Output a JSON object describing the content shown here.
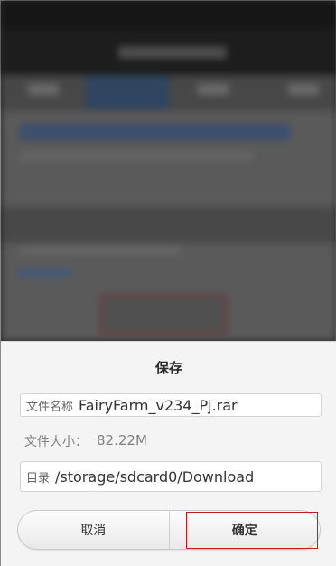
{
  "dialog": {
    "title": "保存",
    "filename_label": "文件名称",
    "filename_value": "FairyFarm_v234_Pj.rar",
    "size_label": "文件大小：",
    "size_value": "82.22M",
    "directory_label": "目录",
    "directory_value": "/storage/sdcard0/Download",
    "cancel_label": "取消",
    "confirm_label": "确定"
  },
  "colors": {
    "dialog_bg": "#f4f4f4",
    "highlight": "#c01c1c"
  }
}
